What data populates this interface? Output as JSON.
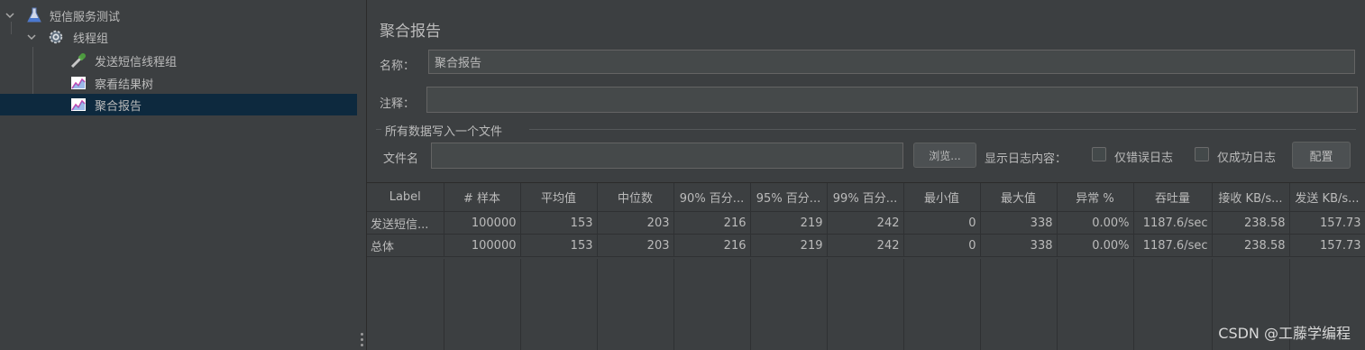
{
  "tree": {
    "root": {
      "label": "短信服务测试",
      "icon": "flask-icon"
    },
    "thread_group": {
      "label": "线程组",
      "icon": "gear-icon"
    },
    "items": [
      {
        "label": "发送短信线程组",
        "icon": "dropper-icon"
      },
      {
        "label": "察看结果树",
        "icon": "chart-icon"
      },
      {
        "label": "聚合报告",
        "icon": "chart-icon",
        "selected": true
      }
    ]
  },
  "panel": {
    "title": "聚合报告",
    "name_label": "名称：",
    "name_value": "聚合报告",
    "comment_label": "注释：",
    "comment_value": "",
    "group_title": "所有数据写入一个文件",
    "filename_label": "文件名",
    "filename_value": "",
    "browse_button": "浏览...",
    "log_label": "显示日志内容：",
    "errors_only": "仅错误日志",
    "success_only": "仅成功日志",
    "config_button": "配置"
  },
  "table": {
    "headers": [
      "Label",
      "# 样本",
      "平均值",
      "中位数",
      "90% 百分...",
      "95% 百分...",
      "99% 百分...",
      "最小值",
      "最大值",
      "异常 %",
      "吞吐量",
      "接收 KB/s...",
      "发送 KB/s..."
    ],
    "rows": [
      [
        "发送短信...",
        "100000",
        "153",
        "203",
        "216",
        "219",
        "242",
        "0",
        "338",
        "0.00%",
        "1187.6/sec",
        "238.58",
        "157.73"
      ],
      [
        "总体",
        "100000",
        "153",
        "203",
        "216",
        "219",
        "242",
        "0",
        "338",
        "0.00%",
        "1187.6/sec",
        "238.58",
        "157.73"
      ]
    ]
  },
  "watermark": "CSDN @工藤学编程",
  "colors": {
    "background": "#3c3f41",
    "selection": "#0d293e",
    "text": "#bbbbbb"
  }
}
